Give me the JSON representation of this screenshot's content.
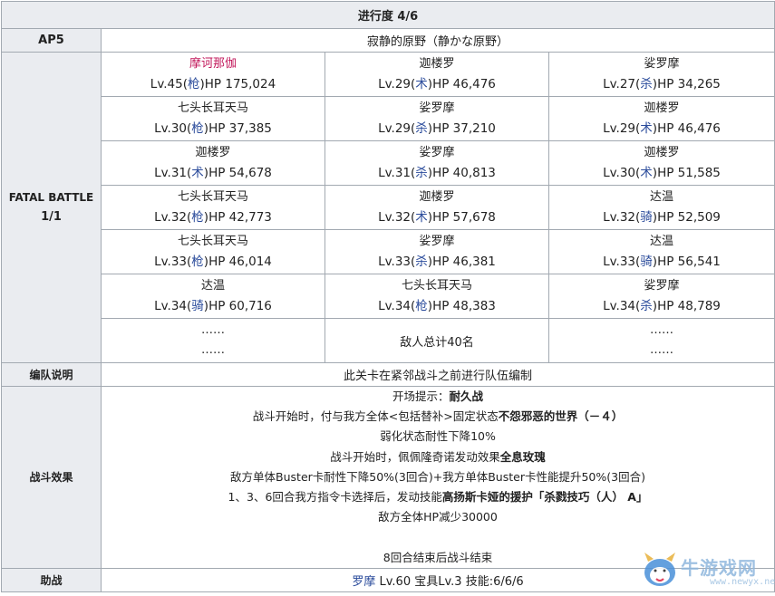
{
  "header": {
    "title": "进行度 4/6"
  },
  "ap": {
    "label": "AP5",
    "location": "寂静的原野（静かな原野）"
  },
  "battle": {
    "label": "FATAL BATTLE",
    "progress": "1/1",
    "rows": [
      [
        {
          "name": "摩诃那伽",
          "highlight": true,
          "lv": "Lv.45(",
          "cls": "枪",
          "hp": ")HP 175,024"
        },
        {
          "name": "迦楼罗",
          "lv": "Lv.29(",
          "cls": "术",
          "hp": ")HP 46,476"
        },
        {
          "name": "娑罗摩",
          "lv": "Lv.27(",
          "cls": "杀",
          "hp": ")HP 34,265"
        }
      ],
      [
        {
          "name": "七头长耳天马",
          "lv": "Lv.30(",
          "cls": "枪",
          "hp": ")HP 37,385"
        },
        {
          "name": "娑罗摩",
          "lv": "Lv.29(",
          "cls": "杀",
          "hp": ")HP 37,210"
        },
        {
          "name": "迦楼罗",
          "lv": "Lv.29(",
          "cls": "术",
          "hp": ")HP 46,476"
        }
      ],
      [
        {
          "name": "迦楼罗",
          "lv": "Lv.31(",
          "cls": "术",
          "hp": ")HP 54,678"
        },
        {
          "name": "娑罗摩",
          "lv": "Lv.31(",
          "cls": "杀",
          "hp": ")HP 40,813"
        },
        {
          "name": "迦楼罗",
          "lv": "Lv.30(",
          "cls": "术",
          "hp": ")HP 51,585"
        }
      ],
      [
        {
          "name": "七头长耳天马",
          "lv": "Lv.32(",
          "cls": "枪",
          "hp": ")HP 42,773"
        },
        {
          "name": "迦楼罗",
          "lv": "Lv.32(",
          "cls": "术",
          "hp": ")HP 57,678"
        },
        {
          "name": "达温",
          "lv": "Lv.32(",
          "cls": "骑",
          "hp": ")HP 52,509"
        }
      ],
      [
        {
          "name": "七头长耳天马",
          "lv": "Lv.33(",
          "cls": "枪",
          "hp": ")HP 46,014"
        },
        {
          "name": "娑罗摩",
          "lv": "Lv.33(",
          "cls": "杀",
          "hp": ")HP 46,381"
        },
        {
          "name": "达温",
          "lv": "Lv.33(",
          "cls": "骑",
          "hp": ")HP 56,541"
        }
      ],
      [
        {
          "name": "达温",
          "lv": "Lv.34(",
          "cls": "骑",
          "hp": ")HP 60,716"
        },
        {
          "name": "七头长耳天马",
          "lv": "Lv.34(",
          "cls": "枪",
          "hp": ")HP 48,383"
        },
        {
          "name": "娑罗摩",
          "lv": "Lv.34(",
          "cls": "杀",
          "hp": ")HP 48,789"
        }
      ]
    ],
    "more_left": [
      "……",
      "……"
    ],
    "total": "敌人总计40名",
    "more_right": [
      "……",
      "……"
    ]
  },
  "formation": {
    "label": "编队说明",
    "text": "此关卡在紧邻战斗之前进行队伍编制"
  },
  "effects": {
    "label": "战斗效果",
    "lines": [
      [
        {
          "t": "开场提示："
        },
        {
          "t": "耐久战",
          "b": true
        }
      ],
      [
        {
          "t": "战斗开始时，付与我方全体<包括替补>固定状态"
        },
        {
          "t": "不怨邪恶的世界（－４）",
          "b": true
        }
      ],
      [
        {
          "t": "弱化状态耐性下降10%"
        }
      ],
      [
        {
          "t": "战斗开始时，佩佩隆奇诺发动效果"
        },
        {
          "t": "全息玫瑰",
          "b": true
        }
      ],
      [
        {
          "t": "敌方单体Buster卡耐性下降50%(3回合)+我方单体Buster卡性能提升50%(3回合)"
        }
      ],
      [
        {
          "t": "1、3、6回合我方指令卡选择后，发动技能"
        },
        {
          "t": "高扬斯卡娅的援护「杀戮技巧（人） A」",
          "b": true
        }
      ],
      [
        {
          "t": "敌方全体HP减少30000"
        }
      ],
      [
        {
          "t": ""
        }
      ],
      [
        {
          "t": "8回合结束后战斗结束"
        }
      ]
    ]
  },
  "support": {
    "label": "助战",
    "servant": "罗摩",
    "detail": " Lv.60 宝具Lv.3 技能:6/6/6"
  },
  "watermark": {
    "text": "牛游戏网",
    "url": "www.newyx.net"
  },
  "colors": {
    "header_bg": "#eaecf0",
    "border": "#a2a9b1",
    "boss_name": "#c2185b",
    "class_link": "#2a4b9b"
  }
}
